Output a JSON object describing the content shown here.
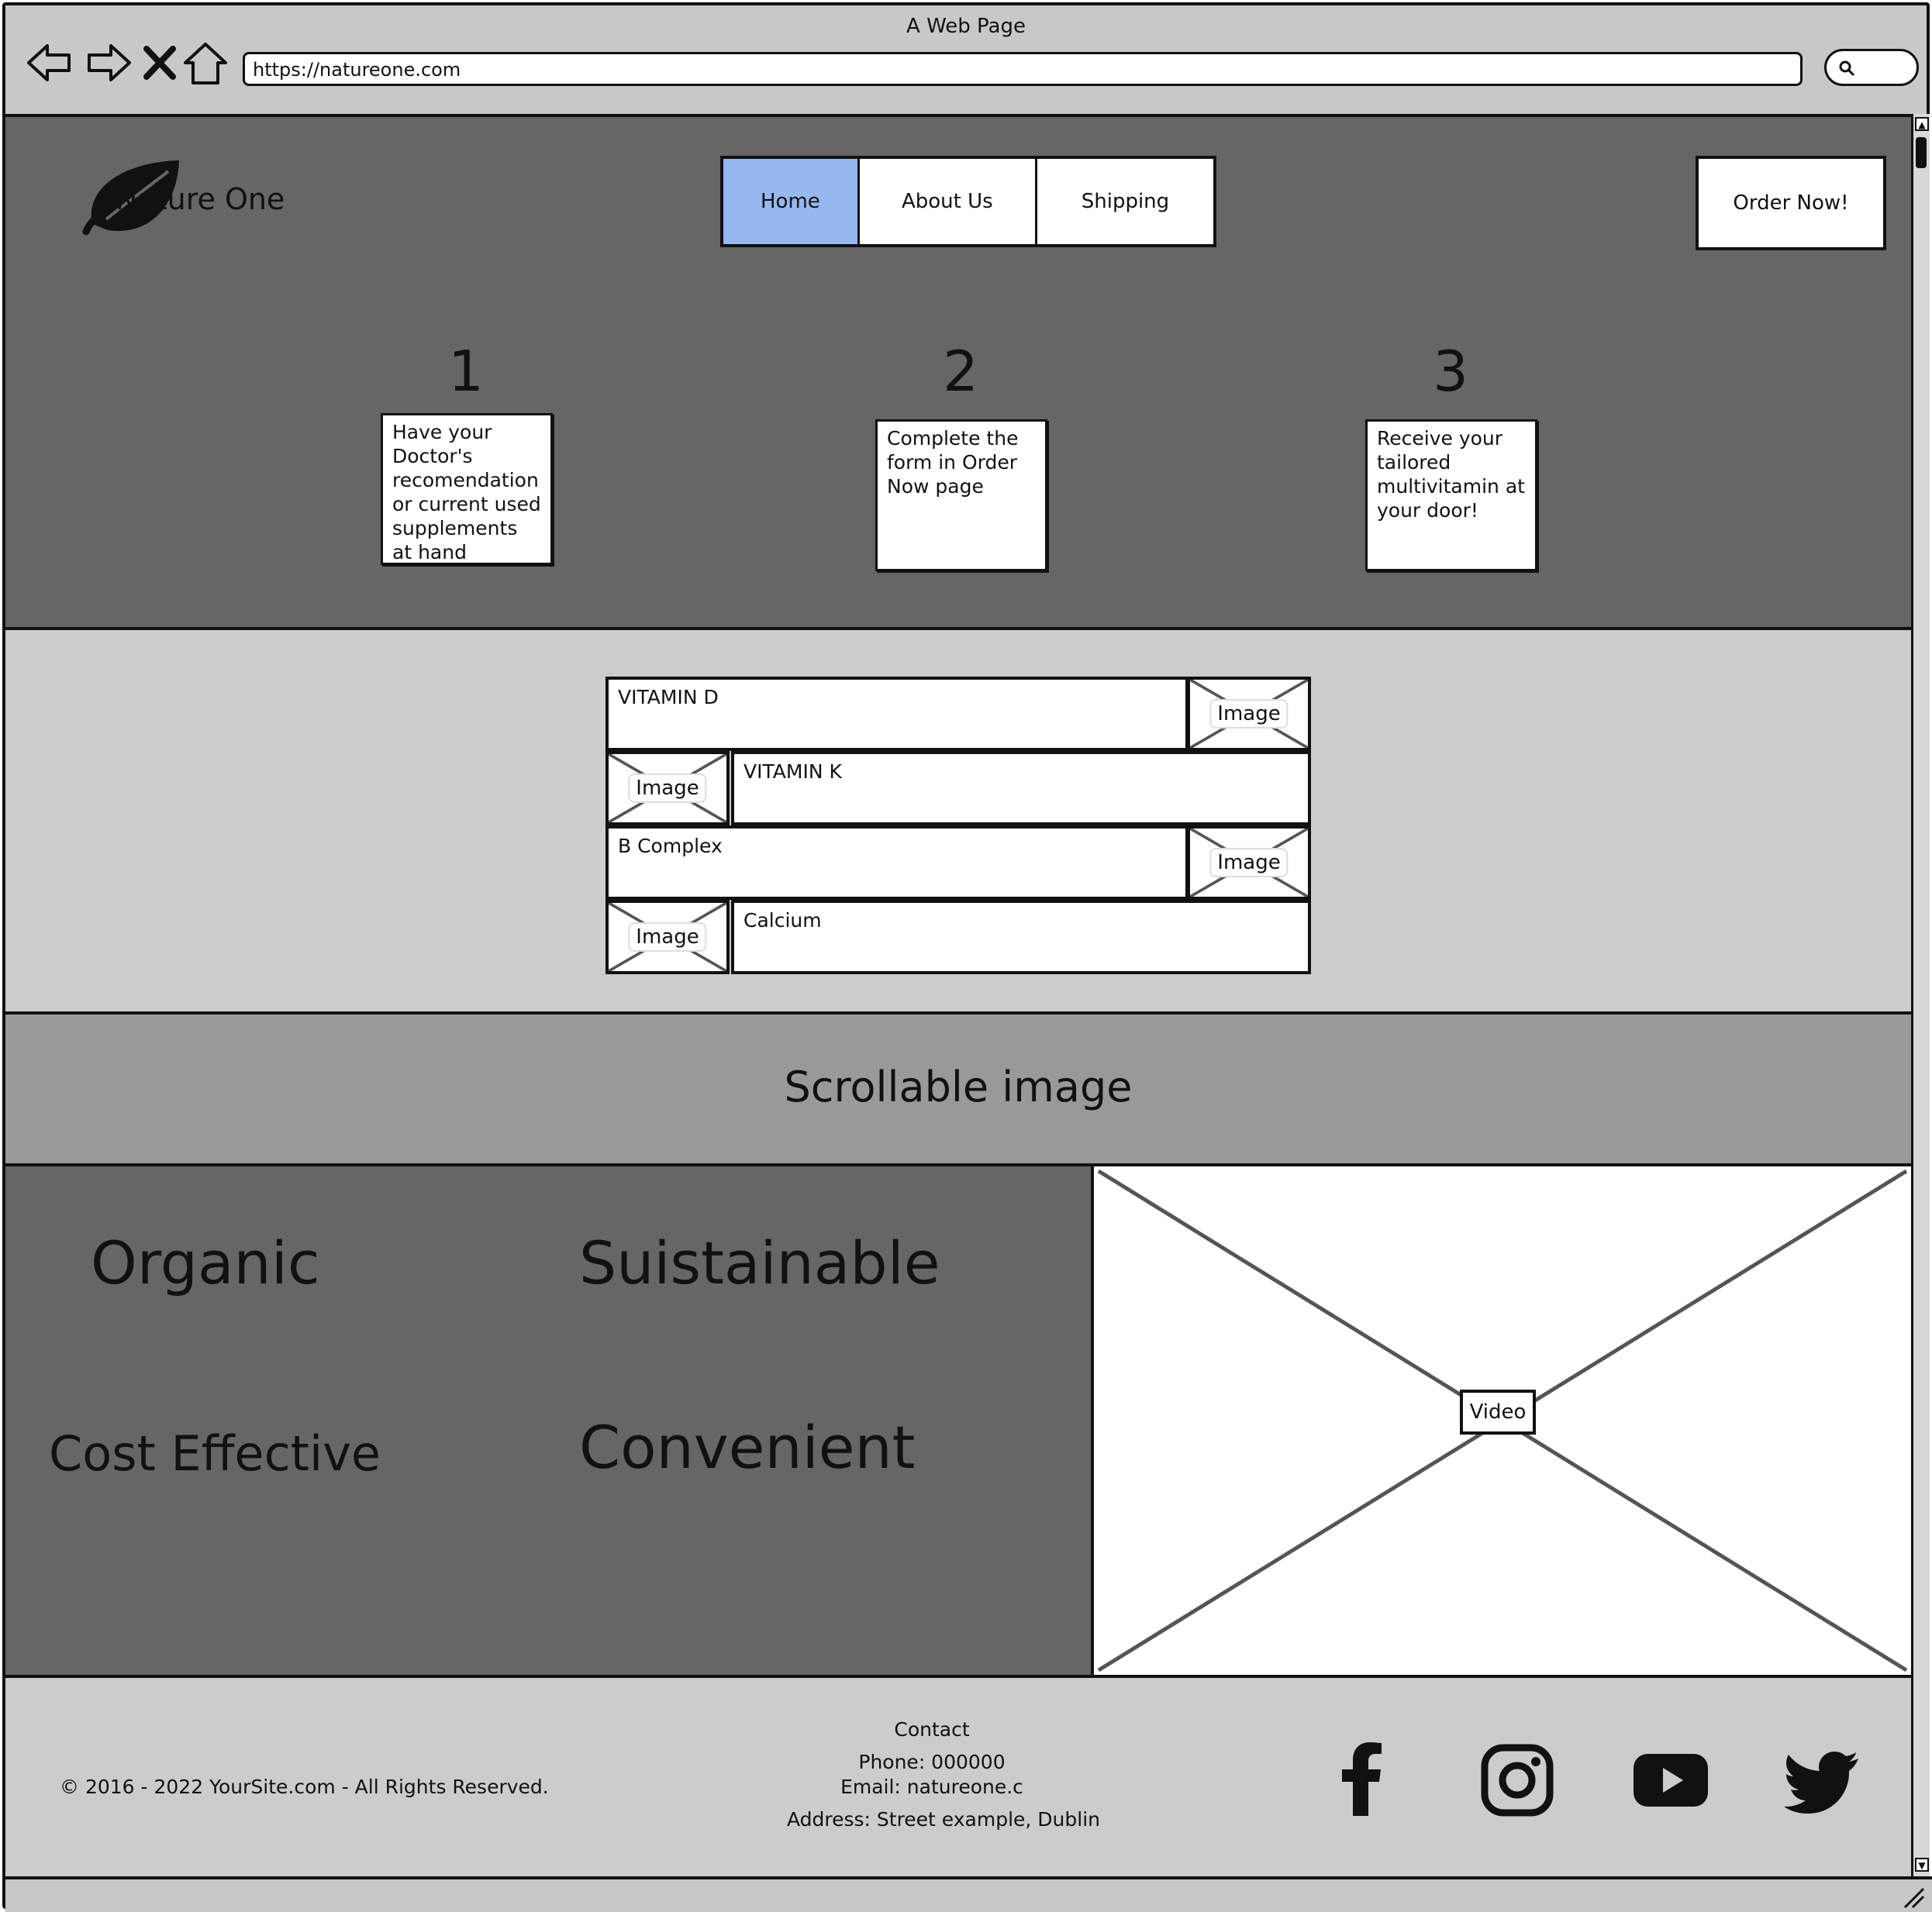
{
  "browser": {
    "window_title": "A Web Page",
    "url": "https://natureone.com"
  },
  "header": {
    "brand_name": "Nature One",
    "nav": [
      {
        "label": "Home",
        "active": true
      },
      {
        "label": "About Us",
        "active": false
      },
      {
        "label": "Shipping",
        "active": false
      }
    ],
    "order_button": "Order Now!"
  },
  "steps": [
    {
      "number": "1",
      "text": "Have your Doctor's recomendation or current used supplements at hand"
    },
    {
      "number": "2",
      "text": "Complete the form in Order Now page"
    },
    {
      "number": "3",
      "text": "Receive your tailored multivitamin at your door!"
    }
  ],
  "products": [
    {
      "name": "VITAMIN D",
      "image_label": "Image"
    },
    {
      "name": "VITAMIN K",
      "image_label": "Image"
    },
    {
      "name": "B Complex",
      "image_label": "Image"
    },
    {
      "name": "Calcium",
      "image_label": "Image"
    }
  ],
  "banner": {
    "label": "Scrollable image"
  },
  "features": {
    "organic": "Organic",
    "sustainable": "Suistainable",
    "cost": "Cost Effective",
    "convenient": "Convenient"
  },
  "video": {
    "label": "Video"
  },
  "footer": {
    "copyright": "© 2016 - 2022 YourSite.com - All Rights Reserved.",
    "contact_title": "Contact",
    "phone": "Phone: 000000",
    "email": "Email: natureone.c",
    "address": "Address: Street example, Dublin",
    "social_icons": [
      "facebook-icon",
      "instagram-icon",
      "youtube-icon",
      "twitter-icon"
    ]
  },
  "colors": {
    "active_nav": "#96b8ef",
    "hero_bg": "#666666",
    "products_bg": "#cccccc",
    "banner_bg": "#999999",
    "chrome_bg": "#c8c8c8"
  }
}
